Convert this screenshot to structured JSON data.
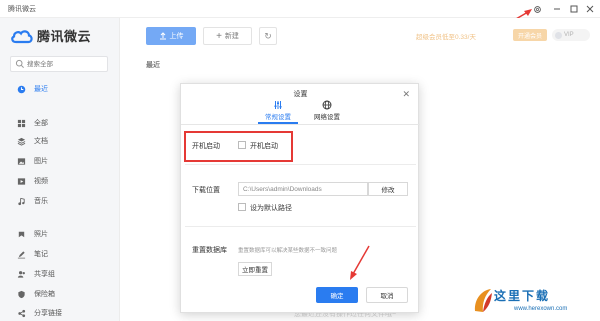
{
  "window": {
    "title": "腾讯微云"
  },
  "logo": {
    "text": "腾讯微云"
  },
  "search": {
    "placeholder": "搜索全部"
  },
  "sidebar": {
    "items": [
      {
        "label": "最近",
        "icon": "clock-icon",
        "active": true
      },
      {
        "label": "全部",
        "icon": "grid-icon"
      },
      {
        "label": "文档",
        "icon": "layers-icon"
      },
      {
        "label": "图片",
        "icon": "image-icon"
      },
      {
        "label": "视频",
        "icon": "video-icon"
      },
      {
        "label": "音乐",
        "icon": "music-icon"
      },
      {
        "label": "照片",
        "icon": "photo-icon"
      },
      {
        "label": "笔记",
        "icon": "pen-icon"
      },
      {
        "label": "共享组",
        "icon": "group-icon"
      },
      {
        "label": "保险箱",
        "icon": "shield-icon"
      },
      {
        "label": "分享链接",
        "icon": "link-icon"
      }
    ]
  },
  "toolbar": {
    "upload_label": "上传",
    "new_label": "新建"
  },
  "header": {
    "promo": "超级会员低至0.33/天",
    "vip_button": "开通会员",
    "user": "VIP"
  },
  "main": {
    "section_title": "最近",
    "hint": "您最近还没有操作过任何文件哦~"
  },
  "dialog": {
    "title": "设置",
    "tabs": [
      {
        "label": "常规设置",
        "active": true
      },
      {
        "label": "网络设置"
      }
    ],
    "autostart": {
      "label": "开机启动",
      "checkbox_label": "开机启动"
    },
    "download": {
      "label": "下载位置",
      "path": "C:\\Users\\admin\\Downloads",
      "modify_label": "修改",
      "default_label": "设为默认路径"
    },
    "reset": {
      "label": "重置数据库",
      "desc": "重置数据库可以解决某些数据不一致问题",
      "button": "立即重置"
    },
    "ok_label": "确定",
    "cancel_label": "取消"
  },
  "watermark": {
    "text": "这里下载",
    "url": "www.herexown.com"
  },
  "colors": {
    "accent": "#2a7cf0",
    "highlight": "#e53935",
    "promo": "#e8a044"
  }
}
